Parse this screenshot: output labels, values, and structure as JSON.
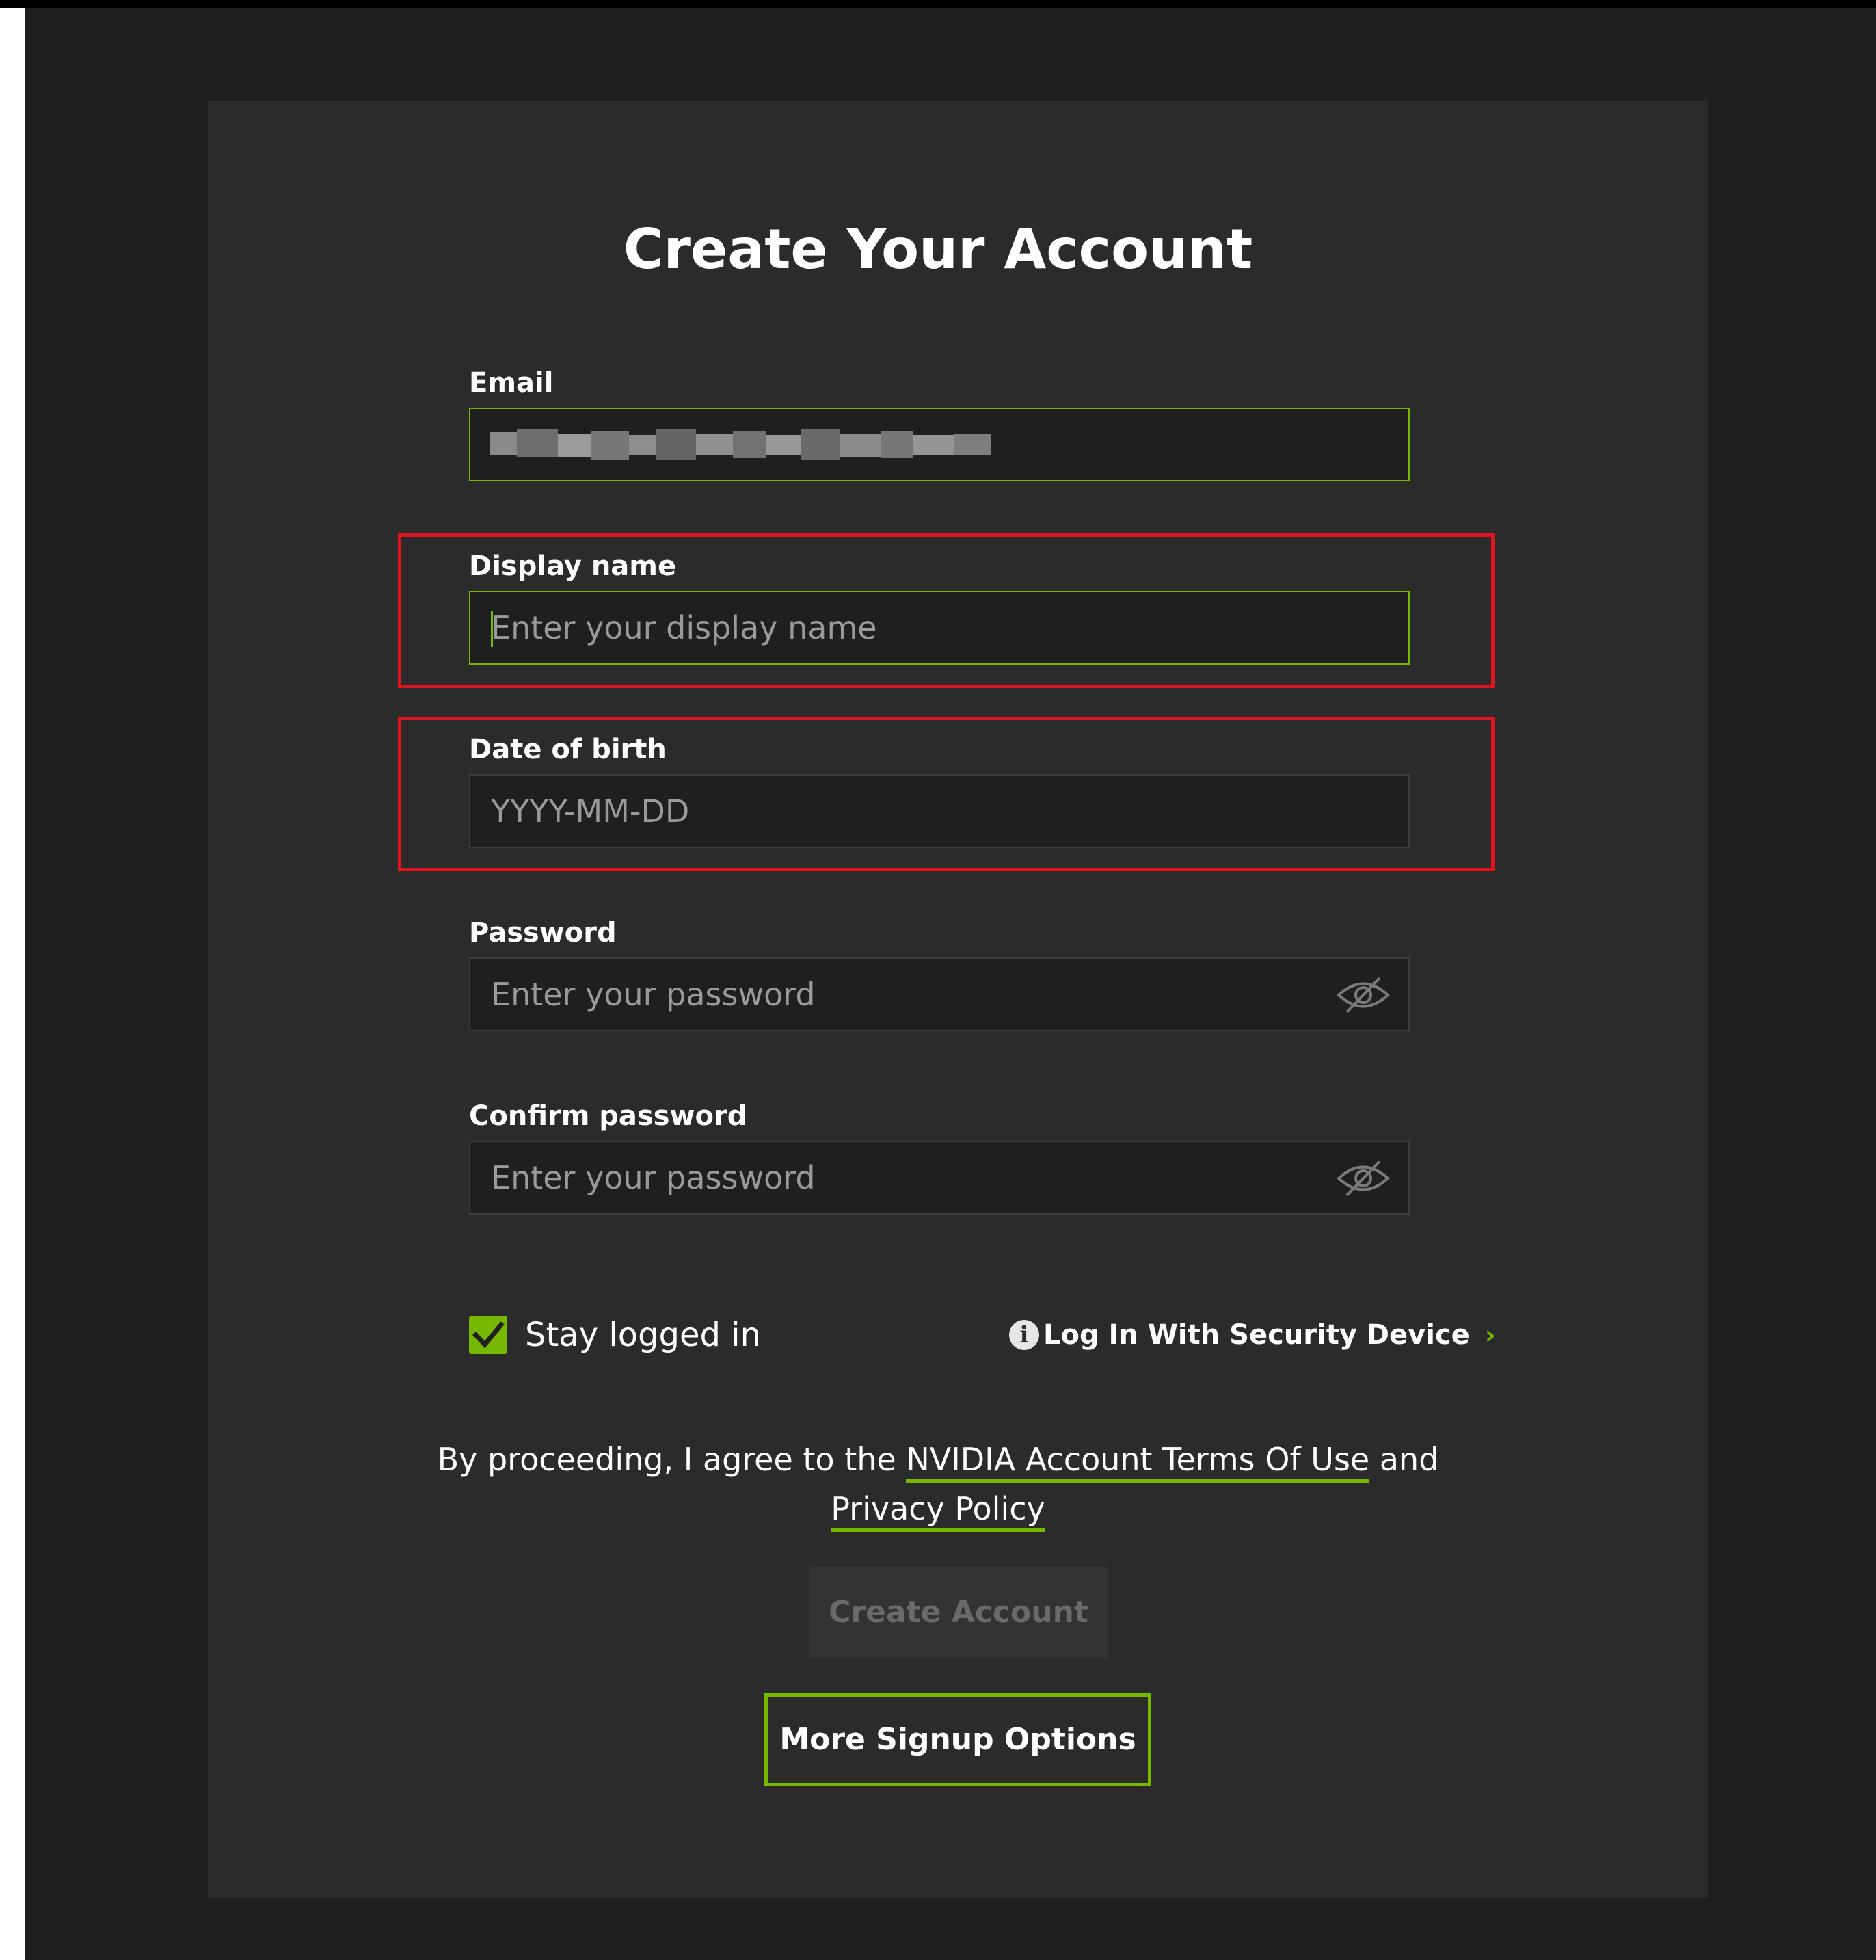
{
  "form": {
    "title": "Create Your Account",
    "email": {
      "label": "Email",
      "value": ""
    },
    "display_name": {
      "label": "Display name",
      "placeholder": "Enter your display name"
    },
    "dob": {
      "label": "Date of birth",
      "placeholder": "YYYY-MM-DD"
    },
    "password": {
      "label": "Password",
      "placeholder": "Enter your password"
    },
    "confirm_password": {
      "label": "Confirm password",
      "placeholder": "Enter your password"
    },
    "stay_logged_in": {
      "label": "Stay logged in",
      "checked": true
    },
    "security_device": {
      "label": "Log In With Security Device",
      "info_glyph": "i",
      "chevron": "›"
    },
    "agreement": {
      "prefix": "By proceeding, I agree to the ",
      "terms_link": "NVIDIA Account Terms Of Use",
      "middle": " and",
      "privacy_link": "Privacy Policy"
    },
    "create_button": "Create Account",
    "more_options_button": "More Signup Options"
  },
  "icons": {
    "password_toggle": "eye-slash-icon",
    "confirm_toggle": "eye-slash-icon",
    "checkbox": "checkmark-icon",
    "info": "info-icon",
    "chevron": "chevron-right-icon"
  },
  "colors": {
    "accent": "#76b900",
    "highlight": "#e0141e",
    "card_bg": "#2b2b2b",
    "page_bg": "#1f1f1f"
  }
}
